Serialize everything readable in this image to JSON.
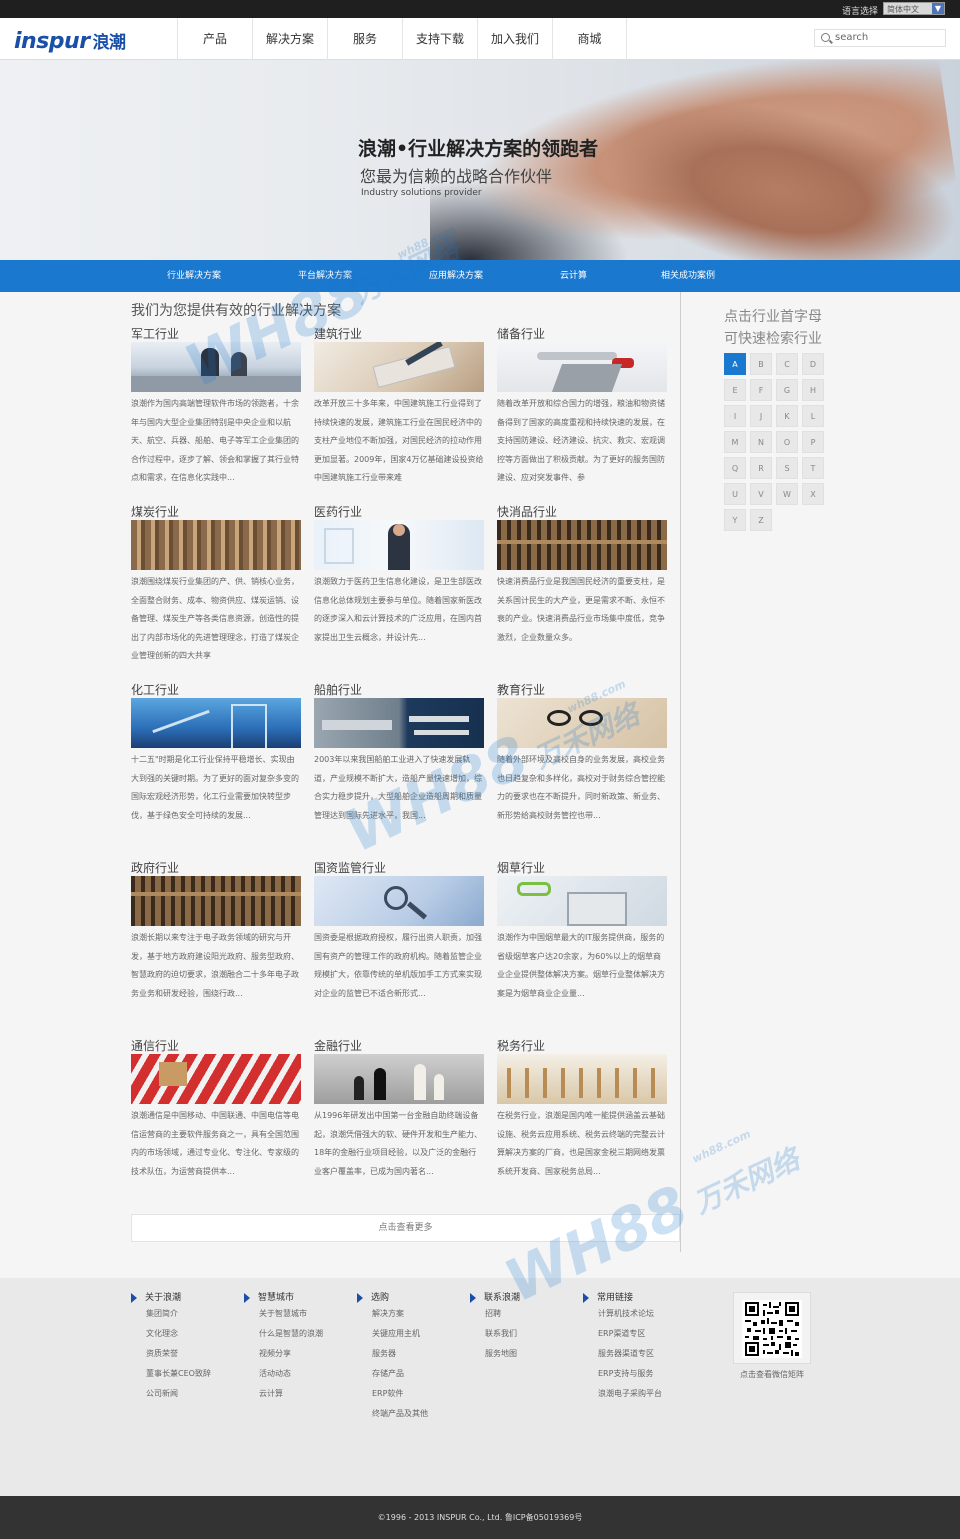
{
  "topbar": {
    "lang_label": "语言选择",
    "lang_value": "简体中文"
  },
  "brand": {
    "logo_en": "inspur",
    "logo_cn": "浪潮"
  },
  "nav": [
    "产品",
    "解决方案",
    "服务",
    "支持下载",
    "加入我们",
    "商城"
  ],
  "search": {
    "placeholder": "search"
  },
  "banner": {
    "title": "浪潮•行业解决方案的领跑者",
    "subtitle": "您最为信赖的战略合作伙伴",
    "en": "Industry solutions provider"
  },
  "subnav": [
    "行业解决方案",
    "平台解决方案",
    "应用解决方案",
    "云计算",
    "相关成功案例"
  ],
  "main": {
    "title": "我们为您提供有效的行业解决方案",
    "more": "点击查看更多"
  },
  "industries": [
    {
      "name": "军工行业",
      "desc": "浪潮作为国内高端管理软件市场的领跑者，十余年与国内大型企业集团特别是中央企业和以航天、航空、兵器、船舶、电子等军工企业集团的合作过程中，逐步了解、领会和掌握了其行业特点和需求，在信息化实践中..."
    },
    {
      "name": "建筑行业",
      "desc": "改革开放三十多年来，中国建筑施工行业得到了持续快速的发展，建筑施工行业在国民经济中的支柱产业地位不断加强，对国民经济的拉动作用更加显著。2009年，国家4万亿基础建设投资给中国建筑施工行业带来难"
    },
    {
      "name": "储备行业",
      "desc": "随着改革开放和综合国力的增强，粮油和物资储备得到了国家的高度重视和持续快速的发展，在支持国防建设、经济建设、抗灾、救灾、宏观调控等方面做出了积极贡献。为了更好的服务国防建设、应对突发事件、参"
    },
    {
      "name": "煤炭行业",
      "desc": "浪潮围绕煤炭行业集团的产、供、销核心业务，全面整合财务、成本、物资供应、煤炭运销、设备管理、煤炭生产等各类信息资源，创造性的提出了内部市场化的先进管理理念，打造了煤炭企业管理创新的四大共享"
    },
    {
      "name": "医药行业",
      "desc": "浪潮致力于医药卫生信息化建设，是卫生部医改信息化总体规划主要参与单位。随着国家新医改的逐步深入和云计算技术的广泛应用，在国内首家提出卫生云概念，并设计先..."
    },
    {
      "name": "快消品行业",
      "desc": "快速消费品行业是我国国民经济的重要支柱，是关系国计民生的大产业，更是需求不断、永恒不衰的产业。快速消费品行业市场集中度低，竞争激烈，企业数量众多。"
    },
    {
      "name": "化工行业",
      "desc": "十二五\"时期是化工行业保持平稳增长、实现由大到强的关键时期。为了更好的面对复杂多变的国际宏观经济形势，化工行业需要加快转型步伐，基于绿色安全可持续的发展..."
    },
    {
      "name": "船舶行业",
      "desc": "2003年以来我国船舶工业进入了快速发展轨道，产业规模不断扩大，造船产量快速增加，综合实力稳步提升，大型船舶企业造船周期和质量管理达到国际先进水平，我国..."
    },
    {
      "name": "教育行业",
      "desc": "随着外部环境及高校自身的业务发展，高校业务也日趋复杂和多样化，高校对于财务综合管控能力的要求也在不断提升，同时新政策、新业务、新形势给高校财务管控也带..."
    },
    {
      "name": "政府行业",
      "desc": "浪潮长期以来专注于电子政务领域的研究与开发，基于地方政府建设阳光政府、服务型政府、智慧政府的迫切要求，浪潮融合二十多年电子政务业务和研发经验，围绕行政..."
    },
    {
      "name": "国资监管行业",
      "desc": "国资委是根据政府授权，履行出资人职责，加强国有资产的管理工作的政府机构。随着监管企业规模扩大，依靠传统的单机版加手工方式来实现对企业的监管已不适合新形式..."
    },
    {
      "name": "烟草行业",
      "desc": "浪潮作为中国烟草最大的IT服务提供商，服务的省级烟草客户达20余家，为60%以上的烟草商业企业提供整体解决方案。烟草行业整体解决方案是为烟草商业企业量..."
    },
    {
      "name": "通信行业",
      "desc": "浪潮通信是中国移动、中国联通、中国电信等电信运营商的主要软件服务商之一，具有全国范围内的市场领域，通过专业化、专注化、专家级的技术队伍，为运营商提供本..."
    },
    {
      "name": "金融行业",
      "desc": "从1996年研发出中国第一台金融自助终端设备起，浪潮凭借强大的软、硬件开发和生产能力、18年的金融行业项目经验，以及广泛的金融行业客户覆盖率，已成为国内著名..."
    },
    {
      "name": "税务行业",
      "desc": "在税务行业，浪潮是国内唯一能提供涵盖云基础设施、税务云应用系统、税务云终端的完整云计算解决方案的厂商，也是国家金税三期网络发票系统开发商、国家税务总局..."
    }
  ],
  "sidebar": {
    "title_line1": "点击行业首字母",
    "title_line2": "可快速检索行业",
    "letters": [
      "A",
      "B",
      "C",
      "D",
      "E",
      "F",
      "G",
      "H",
      "I",
      "J",
      "K",
      "L",
      "M",
      "N",
      "O",
      "P",
      "Q",
      "R",
      "S",
      "T",
      "U",
      "V",
      "W",
      "X",
      "Y",
      "Z"
    ],
    "active": "A"
  },
  "footer": {
    "columns": [
      {
        "title": "关于浪潮",
        "links": [
          "集团简介",
          "文化理念",
          "资质荣誉",
          "董事长兼CEO致辞",
          "公司新闻"
        ]
      },
      {
        "title": "智慧城市",
        "links": [
          "关于智慧城市",
          "什么是智慧的浪潮",
          "视频分享",
          "活动动态",
          "云计算"
        ]
      },
      {
        "title": "选购",
        "links": [
          "解决方案",
          "关键应用主机",
          "服务器",
          "存储产品",
          "ERP软件",
          "终端产品及其他"
        ]
      },
      {
        "title": "联系浪潮",
        "links": [
          "招聘",
          "联系我们",
          "服务地图"
        ]
      },
      {
        "title": "常用链接",
        "links": [
          "计算机技术论坛",
          "ERP渠道专区",
          "服务器渠道专区",
          "ERP支持与服务",
          "浪潮电子采购平台"
        ]
      }
    ],
    "qr_label": "点击查看微信矩阵",
    "copyright": "©1996 - 2013 INSPUR Co., Ltd. 鲁ICP备05019369号"
  },
  "watermarks": [
    "wh88.com",
    "WH88",
    "万禾网络"
  ],
  "colors": {
    "brand_blue": "#1a78cf",
    "logo_blue": "#1a4fa8",
    "footer_dark": "#333333"
  }
}
